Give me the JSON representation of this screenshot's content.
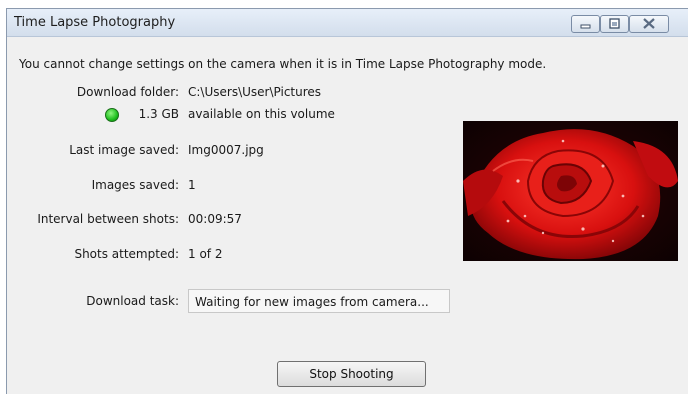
{
  "window": {
    "title": "Time Lapse Photography"
  },
  "message": "You cannot change settings on the camera when it is in Time Lapse Photography mode.",
  "download_folder": {
    "label": "Download folder:",
    "value": "C:\\Users\\User\\Pictures"
  },
  "volume": {
    "size": "1.3 GB",
    "text": "available on this volume",
    "indicator_color": "#22c022"
  },
  "last_image": {
    "label": "Last image saved:",
    "value": "Img0007.jpg"
  },
  "images_saved": {
    "label": "Images saved:",
    "value": "1"
  },
  "interval": {
    "label": "Interval between shots:",
    "value": "00:09:57"
  },
  "shots": {
    "label": "Shots attempted:",
    "value": "1 of 2"
  },
  "download_task": {
    "label": "Download task:",
    "value": "Waiting for new images from camera..."
  },
  "buttons": {
    "stop": "Stop Shooting"
  },
  "icons": {
    "minimize": "minimize-icon",
    "maximize": "maximize-icon",
    "close": "close-icon",
    "status": "green-status-icon"
  }
}
